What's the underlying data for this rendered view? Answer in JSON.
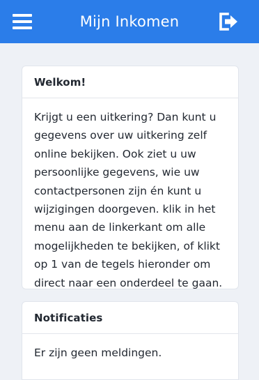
{
  "header": {
    "title": "Mijn Inkomen",
    "menu_icon": "hamburger-menu-icon",
    "logout_icon": "logout-icon",
    "background_color": "#2b7de9"
  },
  "welcome_card": {
    "title": "Welkom!",
    "text": "Krijgt u een uitkering? Dan kunt u gegevens over uw uitkering zelf online bekijken. Ook ziet u uw persoonlijke gegevens, wie uw contactpersonen zijn én kunt u wijzigingen doorgeven. klik in het menu aan de linkerkant om alle mogelijkheden te bekijken, of klikt op 1 van de tegels hieronder om direct naar een onderdeel te gaan."
  },
  "notifications_card": {
    "title": "Notificaties",
    "text": "Er zijn geen meldingen."
  }
}
